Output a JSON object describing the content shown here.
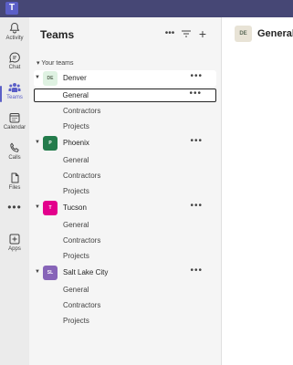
{
  "app": {
    "logo_text": "T"
  },
  "rail": {
    "items": [
      {
        "label": "Activity",
        "icon": "bell-icon"
      },
      {
        "label": "Chat",
        "icon": "chat-icon"
      },
      {
        "label": "Teams",
        "icon": "teams-icon",
        "active": true
      },
      {
        "label": "Calendar",
        "icon": "calendar-icon"
      },
      {
        "label": "Calls",
        "icon": "phone-icon"
      },
      {
        "label": "Files",
        "icon": "file-icon"
      },
      {
        "label": "",
        "icon": "more-icon"
      },
      {
        "label": "Apps",
        "icon": "apps-icon"
      }
    ]
  },
  "panel": {
    "title": "Teams",
    "section_label": "Your teams",
    "teams": [
      {
        "name": "Denver",
        "initials": "DE",
        "avatar_bg": "#dff2e2",
        "avatar_fg": "#5d6b5a",
        "channels": [
          "General",
          "Contractors",
          "Projects"
        ]
      },
      {
        "name": "Phoenix",
        "initials": "P",
        "avatar_bg": "#237b4b",
        "avatar_fg": "#ffffff",
        "channels": [
          "General",
          "Contractors",
          "Projects"
        ]
      },
      {
        "name": "Tucson",
        "initials": "T",
        "avatar_bg": "#e3008c",
        "avatar_fg": "#ffffff",
        "channels": [
          "General",
          "Contractors",
          "Projects"
        ]
      },
      {
        "name": "Salt Lake City",
        "initials": "SL",
        "avatar_bg": "#8764b8",
        "avatar_fg": "#ffffff",
        "channels": [
          "General",
          "Contractors",
          "Projects"
        ]
      }
    ]
  },
  "main": {
    "avatar_initials": "DE",
    "title": "General"
  },
  "colors": {
    "accent": "#5b5fc7",
    "topbar": "#464775"
  }
}
